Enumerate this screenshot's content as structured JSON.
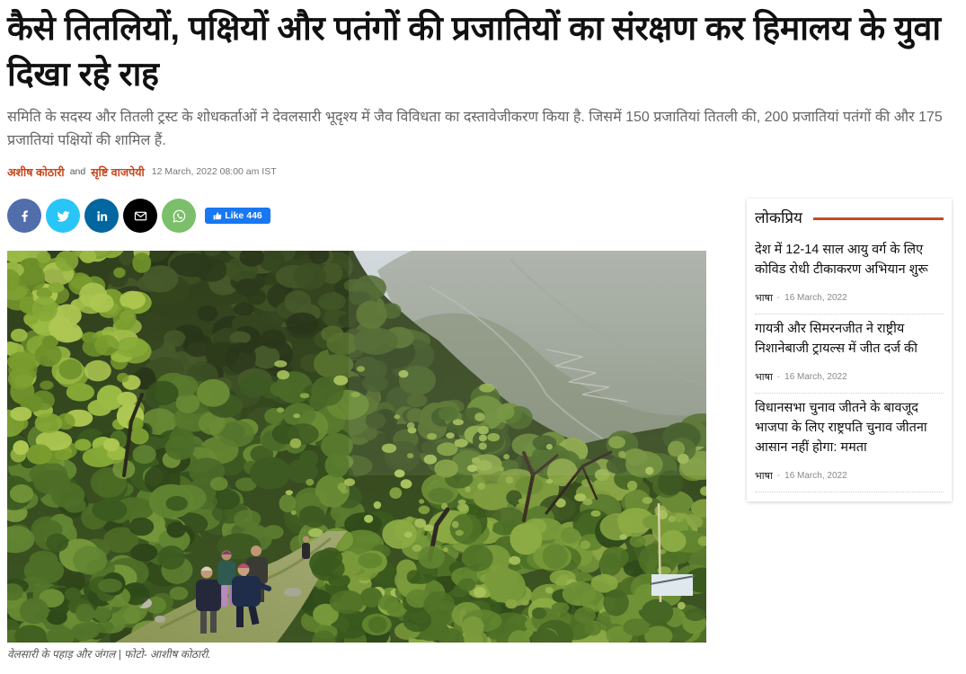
{
  "theme": {
    "accent": "#c8461d",
    "sidebar_rule": "#c34d24",
    "text": "#111111",
    "muted": "#666666"
  },
  "article": {
    "headline": "कैसे तितलियों, पक्षियों और पतंगों की प्रजातियों का संरक्षण कर हिमालय के युवा दिखा रहे राह",
    "summary": "समिति के सदस्य और तितली ट्रस्ट के शोधकर्ताओं ने देवलसारी भूदृश्य में जैव विविधता का दस्तावेजीकरण किया है. जिसमें 150 प्रजातियां तितली की, 200 प्रजातियां पतंगों की और 175 प्रजातियां पक्षियों की शामिल हैं.",
    "byline": {
      "authors": [
        "अशीष कोठारी",
        "सृष्टि वाजपेयी"
      ],
      "joiner": "and",
      "published": "12 March, 2022 08:00 am IST"
    },
    "image_caption": "वेलसारी के पहाड़ और जंगल | फोटो- आशीष कोठारी."
  },
  "share": {
    "buttons": [
      {
        "icon": "facebook-icon",
        "color": "#516eab"
      },
      {
        "icon": "twitter-icon",
        "color": "#29c5f6"
      },
      {
        "icon": "linkedin-icon",
        "color": "#0266a0"
      },
      {
        "icon": "mail-icon",
        "color": "#000000"
      },
      {
        "icon": "whatsapp-icon",
        "color": "#7bbf6a"
      }
    ],
    "like": {
      "icon": "thumbs-up-icon",
      "label": "Like",
      "count": "446",
      "color": "#1877f2"
    }
  },
  "sidebar": {
    "title": "लोकप्रिय",
    "items": [
      {
        "title": "देश में 12-14 साल आयु वर्ग के लिए कोविड रोधी टीकाकरण अभियान शुरू",
        "source": "भाषा",
        "separator": "-",
        "date": "16 March, 2022"
      },
      {
        "title": "गायत्री और सिमरनजीत ने राष्ट्रीय निशानेबाजी ट्रायल्स में जीत दर्ज की",
        "source": "भाषा",
        "separator": "-",
        "date": "16 March, 2022"
      },
      {
        "title": "विधानसभा चुनाव जीतने के बावजूद भाजपा के लिए राष्ट्रपति चुनाव जीतना आसान नहीं होगा: ममता",
        "source": "भाषा",
        "separator": "-",
        "date": "16 March, 2022"
      }
    ]
  }
}
